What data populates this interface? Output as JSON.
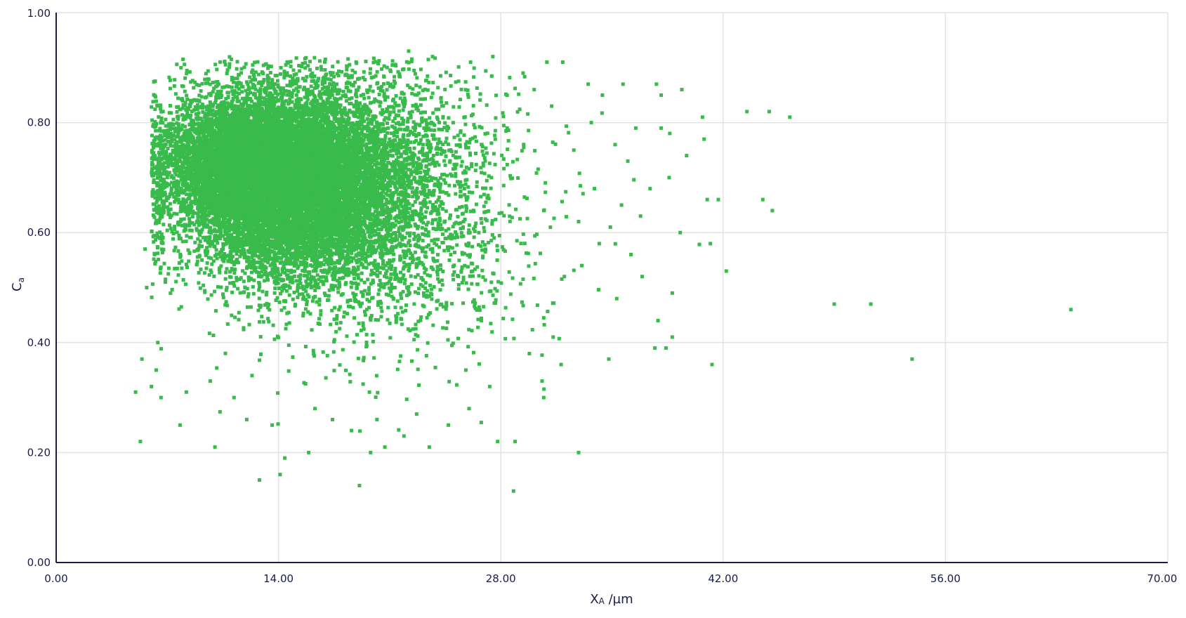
{
  "chart_data": {
    "type": "scatter",
    "title": "",
    "xlabel": "X",
    "xlabel_sub": "A",
    "xlabel_unit": " /µm",
    "ylabel": "C",
    "ylabel_sub": "a",
    "xlim": [
      0,
      70
    ],
    "ylim": [
      0,
      1.0
    ],
    "x_ticks": [
      "0.00",
      "14.00",
      "28.00",
      "42.00",
      "56.00",
      "70.00"
    ],
    "x_tick_values": [
      0,
      14,
      28,
      42,
      56,
      70
    ],
    "y_ticks": [
      "0.00",
      "0.20",
      "0.40",
      "0.60",
      "0.80",
      "1.00"
    ],
    "y_tick_values": [
      0,
      0.2,
      0.4,
      0.6,
      0.8,
      1.0
    ],
    "grid": true,
    "legend": "none",
    "marker_color": "#38bb4b",
    "dense_clusters": [
      {
        "cx": 14.5,
        "cy": 0.7,
        "sx": 3.2,
        "sy": 0.075,
        "count": 9000
      },
      {
        "cx": 11.0,
        "cy": 0.73,
        "sx": 2.2,
        "sy": 0.06,
        "count": 3000
      },
      {
        "cx": 17.0,
        "cy": 0.66,
        "sx": 4.5,
        "sy": 0.11,
        "count": 3500
      },
      {
        "cx": 21.5,
        "cy": 0.66,
        "sx": 4.5,
        "sy": 0.13,
        "count": 1200
      }
    ],
    "sparse_points": [
      [
        5.0,
        0.31
      ],
      [
        5.3,
        0.22
      ],
      [
        5.4,
        0.37
      ],
      [
        6.6,
        0.3
      ],
      [
        7.8,
        0.25
      ],
      [
        10.0,
        0.21
      ],
      [
        12.8,
        0.15
      ],
      [
        14.1,
        0.16
      ],
      [
        14.4,
        0.19
      ],
      [
        15.9,
        0.2
      ],
      [
        19.1,
        0.14
      ],
      [
        19.8,
        0.2
      ],
      [
        20.7,
        0.21
      ],
      [
        23.5,
        0.21
      ],
      [
        27.8,
        0.22
      ],
      [
        28.8,
        0.13
      ],
      [
        28.9,
        0.22
      ],
      [
        32.9,
        0.2
      ],
      [
        34.8,
        0.37
      ],
      [
        37.7,
        0.39
      ],
      [
        38.4,
        0.39
      ],
      [
        38.8,
        0.41
      ],
      [
        41.3,
        0.36
      ],
      [
        41.2,
        0.58
      ],
      [
        42.2,
        0.53
      ],
      [
        41.0,
        0.66
      ],
      [
        41.7,
        0.66
      ],
      [
        44.5,
        0.66
      ],
      [
        45.1,
        0.64
      ],
      [
        43.5,
        0.82
      ],
      [
        44.9,
        0.82
      ],
      [
        46.2,
        0.81
      ],
      [
        49.0,
        0.47
      ],
      [
        51.3,
        0.47
      ],
      [
        53.9,
        0.37
      ],
      [
        63.9,
        0.46
      ],
      [
        39.3,
        0.6
      ],
      [
        38.8,
        0.49
      ],
      [
        37.9,
        0.44
      ],
      [
        36.2,
        0.56
      ],
      [
        35.3,
        0.48
      ],
      [
        36.9,
        0.52
      ],
      [
        39.7,
        0.74
      ],
      [
        40.7,
        0.81
      ],
      [
        40.8,
        0.77
      ],
      [
        39.4,
        0.86
      ],
      [
        38.1,
        0.85
      ],
      [
        37.8,
        0.87
      ],
      [
        35.7,
        0.87
      ],
      [
        36.5,
        0.79
      ],
      [
        34.4,
        0.85
      ],
      [
        33.5,
        0.87
      ],
      [
        31.9,
        0.91
      ],
      [
        30.9,
        0.91
      ],
      [
        27.5,
        0.92
      ],
      [
        22.2,
        0.93
      ],
      [
        23.7,
        0.92
      ],
      [
        38.1,
        0.79
      ],
      [
        38.6,
        0.7
      ],
      [
        37.4,
        0.68
      ],
      [
        36.8,
        0.63
      ],
      [
        35.6,
        0.65
      ],
      [
        34.2,
        0.58
      ],
      [
        33.1,
        0.54
      ],
      [
        32.0,
        0.52
      ],
      [
        31.3,
        0.41
      ],
      [
        31.8,
        0.36
      ],
      [
        30.7,
        0.3
      ],
      [
        29.8,
        0.38
      ],
      [
        30.6,
        0.33
      ],
      [
        27.3,
        0.32
      ],
      [
        26.0,
        0.28
      ],
      [
        24.7,
        0.25
      ],
      [
        25.8,
        0.35
      ],
      [
        22.7,
        0.27
      ],
      [
        21.9,
        0.23
      ],
      [
        20.2,
        0.26
      ],
      [
        18.6,
        0.24
      ],
      [
        17.4,
        0.26
      ],
      [
        16.3,
        0.28
      ],
      [
        13.6,
        0.25
      ],
      [
        12.0,
        0.26
      ],
      [
        11.2,
        0.3
      ],
      [
        9.7,
        0.33
      ],
      [
        8.2,
        0.31
      ],
      [
        6.0,
        0.32
      ],
      [
        6.3,
        0.35
      ],
      [
        5.7,
        0.5
      ],
      [
        5.6,
        0.57
      ],
      [
        6.4,
        0.4
      ],
      [
        33.9,
        0.68
      ],
      [
        34.9,
        0.61
      ],
      [
        36.0,
        0.73
      ],
      [
        35.2,
        0.76
      ],
      [
        33.7,
        0.8
      ],
      [
        32.6,
        0.75
      ],
      [
        31.2,
        0.83
      ],
      [
        30.1,
        0.86
      ],
      [
        29.4,
        0.89
      ],
      [
        26.1,
        0.91
      ]
    ]
  }
}
